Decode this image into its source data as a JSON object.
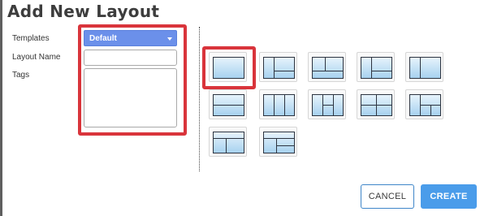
{
  "dialog": {
    "title": "Add New Layout"
  },
  "form": {
    "templates_label": "Templates",
    "templates_value": "Default",
    "layout_name_label": "Layout Name",
    "layout_name_value": "",
    "tags_label": "Tags",
    "tags_value": ""
  },
  "layouts": [
    {
      "name": "layout-single",
      "selected": true
    },
    {
      "name": "layout-left-plus-two-right"
    },
    {
      "name": "layout-top-split-plus-bottom"
    },
    {
      "name": "layout-three-columns-variant"
    },
    {
      "name": "layout-two-columns"
    },
    {
      "name": "layout-two-rows"
    },
    {
      "name": "layout-three-columns"
    },
    {
      "name": "layout-grid-2x2-variant"
    },
    {
      "name": "layout-quad-grid"
    },
    {
      "name": "layout-left-plus-right-stack"
    },
    {
      "name": "layout-top-plus-bottom-split"
    },
    {
      "name": "layout-top-plus-left-and-right-stack"
    }
  ],
  "footer": {
    "cancel_label": "CANCEL",
    "create_label": "CREATE"
  },
  "colors": {
    "primary": "#4a9cea",
    "select_bg": "#6b90ea",
    "highlight_red": "#d9343b",
    "tile_fill_top": "#e8f4fc",
    "tile_fill_bottom": "#a6d1ef"
  }
}
